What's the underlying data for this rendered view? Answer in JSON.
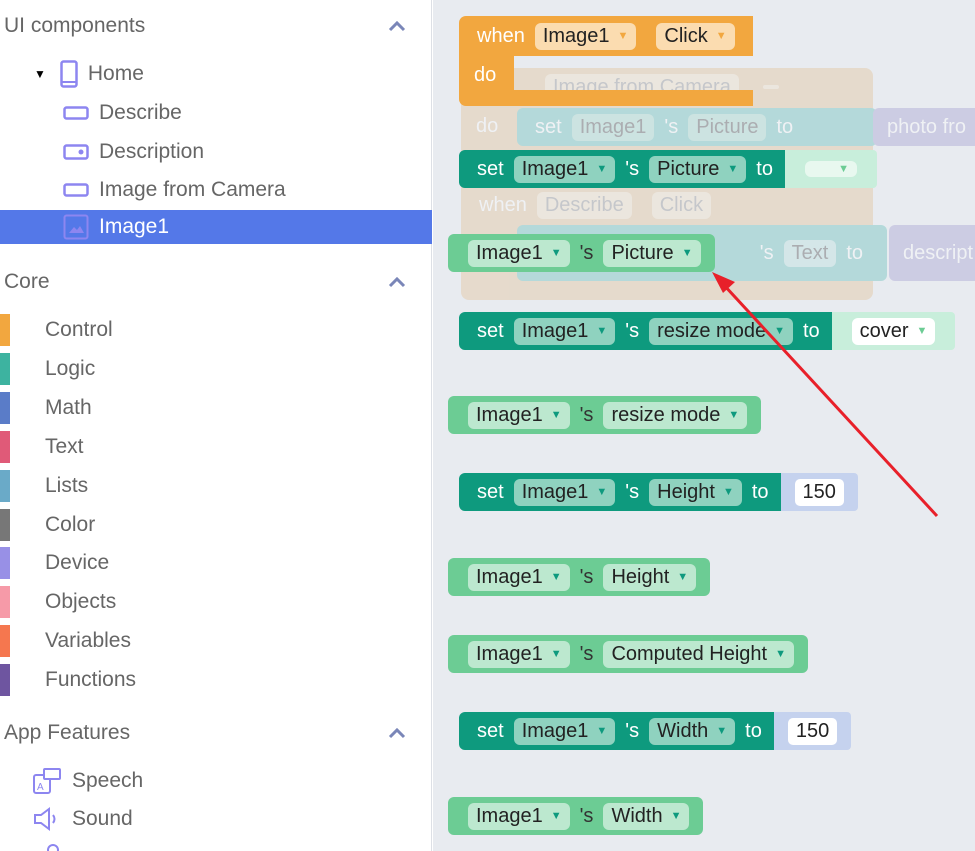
{
  "sidebar": {
    "ui_components": {
      "title": "UI components",
      "items": [
        {
          "label": "Home",
          "icon": "phone-icon"
        },
        {
          "label": "Describe",
          "icon": "button-icon"
        },
        {
          "label": "Description",
          "icon": "textbox-icon"
        },
        {
          "label": "Image from Camera",
          "icon": "button-icon"
        },
        {
          "label": "Image1",
          "icon": "image-icon",
          "selected": true
        }
      ]
    },
    "core": {
      "title": "Core",
      "items": [
        {
          "label": "Control",
          "color": "#f2a73f"
        },
        {
          "label": "Logic",
          "color": "#3db3a0"
        },
        {
          "label": "Math",
          "color": "#5a7cc8"
        },
        {
          "label": "Text",
          "color": "#e05a78"
        },
        {
          "label": "Lists",
          "color": "#6aaac8"
        },
        {
          "label": "Color",
          "color": "#777777"
        },
        {
          "label": "Device",
          "color": "#9890e6"
        },
        {
          "label": "Objects",
          "color": "#f69aa8"
        },
        {
          "label": "Variables",
          "color": "#f5774f"
        },
        {
          "label": "Functions",
          "color": "#6e55a0"
        }
      ]
    },
    "app_features": {
      "title": "App Features",
      "items": [
        {
          "label": "Speech",
          "icon": "speech-icon"
        },
        {
          "label": "Sound",
          "icon": "sound-icon"
        }
      ]
    }
  },
  "workspace": {
    "event": {
      "when": "when",
      "component": "Image1",
      "event": "Click",
      "do": "do"
    },
    "faded": {
      "cam_component": "Image from Camera",
      "cam_event": "Click",
      "do": "do",
      "set": "set",
      "comp": "Image1",
      "poss": "'s",
      "prop": "Picture",
      "to": "to",
      "value": "photo fro",
      "when": "when",
      "describe": "Describe",
      "click": "Click",
      "text_prop": "Text",
      "desc_value": "descript"
    },
    "blocks": [
      {
        "kind": "set",
        "component": "Image1",
        "property": "Picture",
        "value": ""
      },
      {
        "kind": "get",
        "component": "Image1",
        "property": "Picture"
      },
      {
        "kind": "set",
        "component": "Image1",
        "property": "resize mode",
        "value": "cover"
      },
      {
        "kind": "get",
        "component": "Image1",
        "property": "resize mode"
      },
      {
        "kind": "set",
        "component": "Image1",
        "property": "Height",
        "value": "150"
      },
      {
        "kind": "get",
        "component": "Image1",
        "property": "Height"
      },
      {
        "kind": "get",
        "component": "Image1",
        "property": "Computed Height"
      },
      {
        "kind": "set",
        "component": "Image1",
        "property": "Width",
        "value": "150"
      },
      {
        "kind": "get",
        "component": "Image1",
        "property": "Width"
      }
    ],
    "labels": {
      "set": "set",
      "poss": "'s",
      "to": "to"
    },
    "annotation_color": "#e8202a"
  }
}
